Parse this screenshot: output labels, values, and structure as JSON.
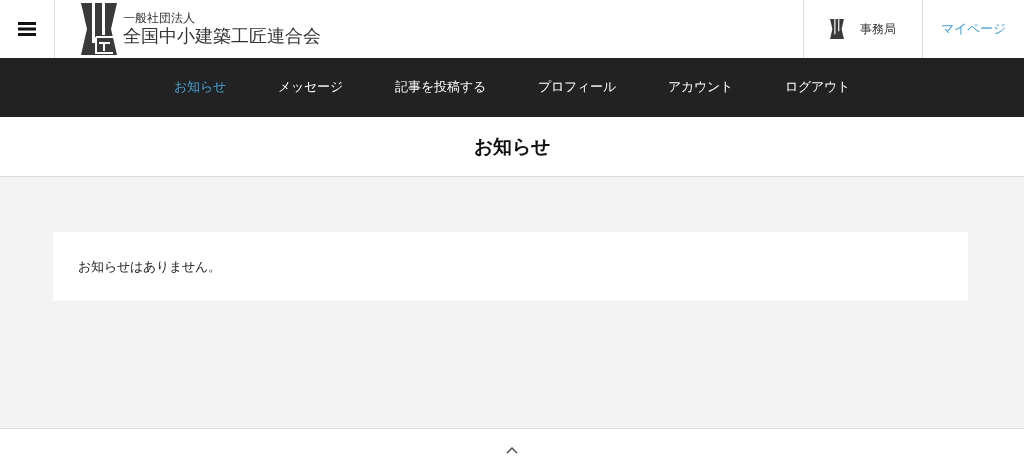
{
  "header": {
    "org_type": "一般社団法人",
    "org_name": "全国中小建築工匠連合会",
    "office_link": "事務局",
    "mypage_link": "マイページ"
  },
  "nav": [
    {
      "label": "お知らせ",
      "selected": true
    },
    {
      "label": "メッセージ",
      "selected": false
    },
    {
      "label": "記事を投稿する",
      "selected": false
    },
    {
      "label": "プロフィール",
      "selected": false
    },
    {
      "label": "アカウント",
      "selected": false
    },
    {
      "label": "ログアウト",
      "selected": false
    }
  ],
  "page_title": "お知らせ",
  "message": "お知らせはありません。"
}
